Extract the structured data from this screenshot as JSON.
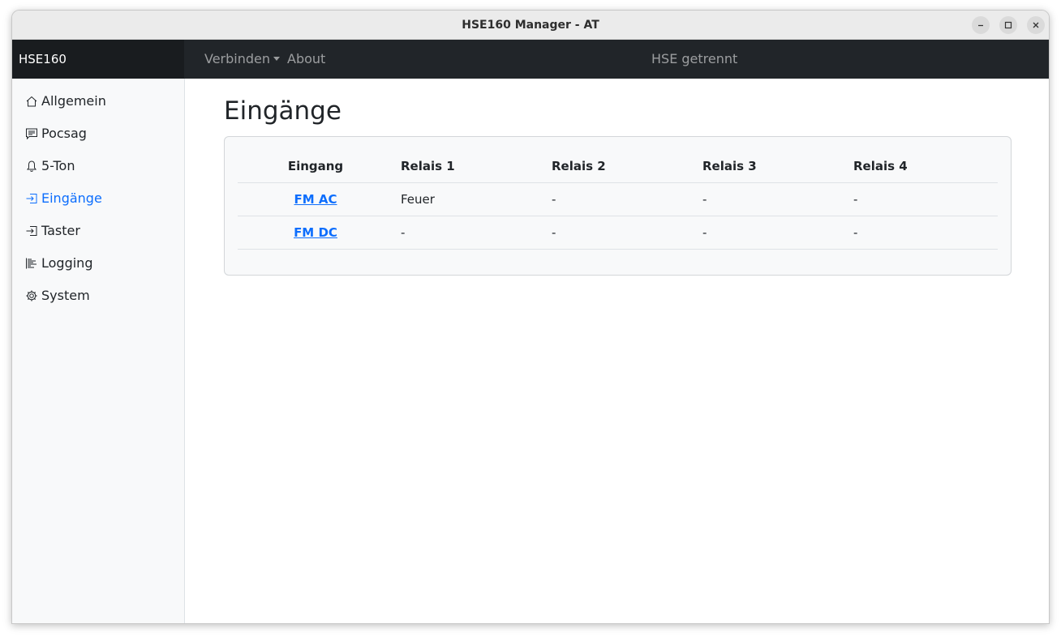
{
  "window": {
    "title": "HSE160 Manager - AT"
  },
  "navbar": {
    "brand": "HSE160",
    "connect_label": "Verbinden",
    "about_label": "About",
    "status": "HSE getrennt"
  },
  "sidebar": {
    "items": [
      {
        "label": "Allgemein",
        "icon": "house-icon"
      },
      {
        "label": "Pocsag",
        "icon": "message-icon"
      },
      {
        "label": "5-Ton",
        "icon": "bell-icon"
      },
      {
        "label": "Eingänge",
        "icon": "input-icon",
        "active": true
      },
      {
        "label": "Taster",
        "icon": "input-icon"
      },
      {
        "label": "Logging",
        "icon": "log-icon"
      },
      {
        "label": "System",
        "icon": "gear-icon"
      }
    ]
  },
  "main": {
    "title": "Eingänge",
    "table": {
      "headers": [
        "Eingang",
        "Relais 1",
        "Relais 2",
        "Relais 3",
        "Relais 4"
      ],
      "rows": [
        [
          "FM AC",
          "Feuer",
          "-",
          "-",
          "-"
        ],
        [
          "FM DC",
          "-",
          "-",
          "-",
          "-"
        ]
      ]
    }
  },
  "colors": {
    "accent": "#0d6efd",
    "navbar": "#212529",
    "sidebar": "#f8f9fa"
  }
}
